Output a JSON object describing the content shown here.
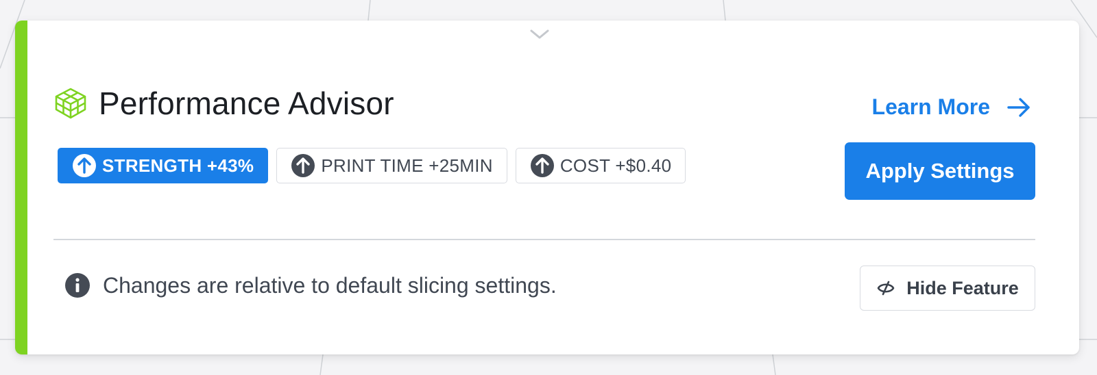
{
  "panel": {
    "title": "Performance Advisor",
    "title_icon": "infill-cube-icon",
    "collapse_icon": "chevron-down-icon",
    "learn_more": {
      "label": "Learn More",
      "icon": "arrow-right-icon"
    },
    "metrics": [
      {
        "label": "STRENGTH +43%",
        "icon": "arrow-up-circle-icon",
        "active": true
      },
      {
        "label": "PRINT TIME +25MIN",
        "icon": "arrow-up-circle-icon",
        "active": false
      },
      {
        "label": "COST +$0.40",
        "icon": "arrow-up-circle-icon",
        "active": false
      }
    ],
    "apply_button": "Apply Settings",
    "info": {
      "icon": "info-icon",
      "text": "Changes are relative to default slicing settings."
    },
    "hide_button": {
      "label": "Hide Feature",
      "icon": "eye-slash-icon"
    }
  },
  "colors": {
    "accent_green": "#7ed321",
    "primary_blue": "#1a7fe8",
    "text_dark": "#1c1f24",
    "text_muted": "#404752"
  }
}
